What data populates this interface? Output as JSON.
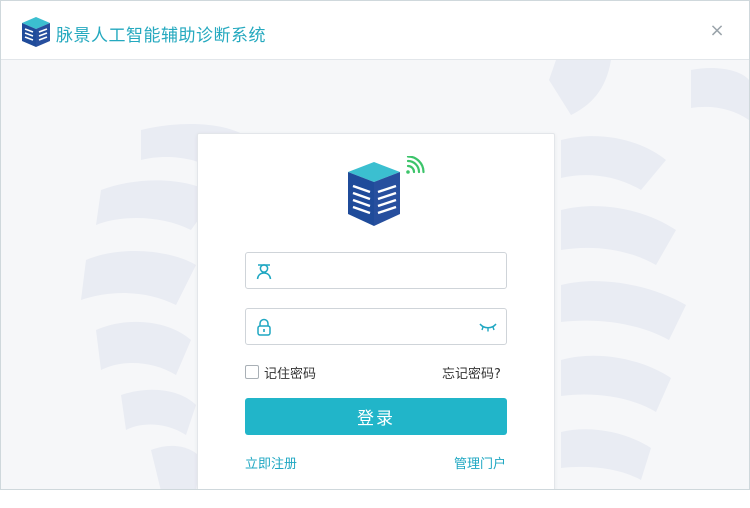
{
  "window": {
    "title": "脉景人工智能辅助诊断系统",
    "close_label": "×"
  },
  "login": {
    "username": {
      "value": "",
      "placeholder": ""
    },
    "password": {
      "value": "",
      "placeholder": ""
    },
    "remember_label": "记住密码",
    "remember_checked": false,
    "forgot_label": "忘记密码?",
    "submit_label": "登录",
    "register_label": "立即注册",
    "portal_label": "管理门户"
  },
  "icons": {
    "app_logo": "zebra-cube-logo-icon",
    "card_logo": "zebra-cube-logo-icon",
    "signal": "wifi-signal-icon",
    "user": "user-icon",
    "lock": "lock-icon",
    "eye": "eye-closed-icon",
    "close": "close-icon"
  },
  "colors": {
    "accent": "#21b5c9",
    "title": "#25a9bf",
    "link": "#1fa7c2",
    "logo_top": "#3bbfd0",
    "logo_side": "#1f4b9a",
    "signal": "#3cc46a",
    "background_stripes": "#e6e9f1"
  }
}
